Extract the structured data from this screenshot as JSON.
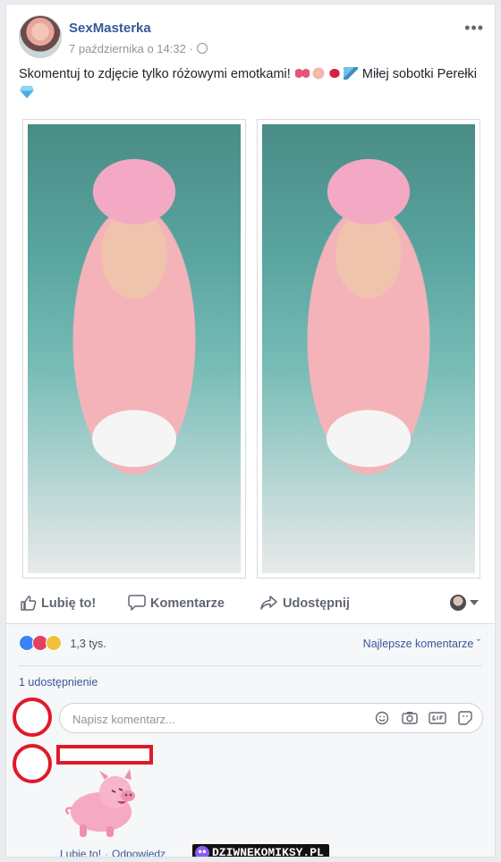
{
  "post": {
    "author": "SexMasterka",
    "timestamp": "7 października o 14:32",
    "more_label": "•••",
    "text_part1": "Skomentuj to zdjęcie tylko różowymi emotkami!",
    "text_part2": "Miłej sobotki Perełki",
    "emoji_icons": [
      "ribbon-icon",
      "cherry-blossom-icon",
      "lips-icon",
      "mermaid-tail-icon",
      "gem-icon"
    ]
  },
  "actions": {
    "like_label": "Lubię to!",
    "comment_label": "Komentarze",
    "share_label": "Udostępnij"
  },
  "stats": {
    "reactions_count": "1,3 tys.",
    "sort_label": "Najlepsze komentarze",
    "shares_label": "1 udostępnienie",
    "reaction_icons": [
      "like-icon",
      "love-icon",
      "sad-icon"
    ]
  },
  "comment_box": {
    "placeholder": "Napisz komentarz..."
  },
  "reply": {
    "like_label": "Lubię to!",
    "reply_label": "Odpowiedz",
    "sticker": "pig-sticker"
  },
  "watermark": {
    "text": "DZIWNEKOMIKSY.PL"
  },
  "colors": {
    "link": "#365899",
    "annotation_red": "#e0192a",
    "background": "#e9ebee"
  }
}
